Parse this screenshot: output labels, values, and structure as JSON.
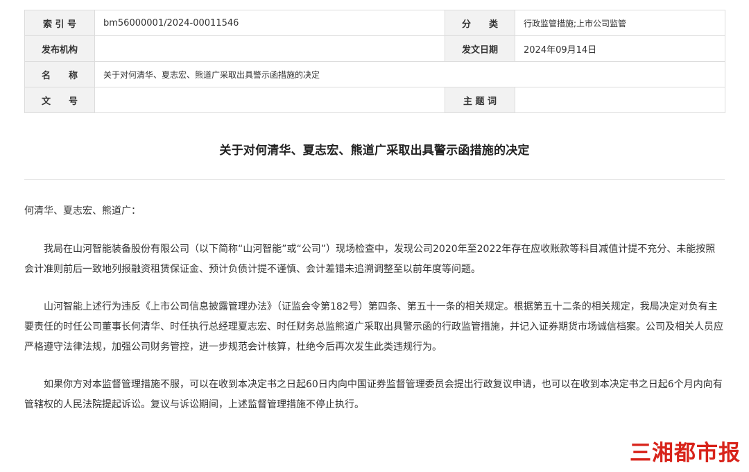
{
  "meta": {
    "index_label": "索 引 号",
    "index_value": "bm56000001/2024-00011546",
    "category_label": "分　　类",
    "category_value": "行政监管措施;上市公司监管",
    "issuer_label": "发布机构",
    "issuer_value": "",
    "date_label": "发文日期",
    "date_value": "2024年09月14日",
    "name_label": "名　　称",
    "name_value": "关于对何清华、夏志宏、熊道广采取出具警示函措施的决定",
    "docno_label": "文　　号",
    "docno_value": "",
    "keywords_label": "主 题 词",
    "keywords_value": ""
  },
  "document": {
    "title": "关于对何清华、夏志宏、熊道广采取出具警示函措施的决定",
    "salutation": "何清华、夏志宏、熊道广：",
    "paragraphs": [
      "我局在山河智能装备股份有限公司（以下简称“山河智能”或“公司”）现场检查中，发现公司2020年至2022年存在应收账款等科目减值计提不充分、未能按照会计准则前后一致地列报融资租赁保证金、预计负债计提不谨慎、会计差错未追溯调整至以前年度等问题。",
      "山河智能上述行为违反《上市公司信息披露管理办法》（证监会令第182号）第四条、第五十一条的相关规定。根据第五十二条的相关规定，我局决定对负有主要责任的时任公司董事长何清华、时任执行总经理夏志宏、时任财务总监熊道广采取出具警示函的行政监管措施，并记入证券期货市场诚信档案。公司及相关人员应严格遵守法律法规，加强公司财务管控，进一步规范会计核算，杜绝今后再次发生此类违规行为。",
      "如果你方对本监督管理措施不服，可以在收到本决定书之日起60日内向中国证券监督管理委员会提出行政复议申请，也可以在收到本决定书之日起6个月内向有管辖权的人民法院提起诉讼。复议与诉讼期间，上述监督管理措施不停止执行。"
    ]
  },
  "watermark": {
    "text": "三湘都市报",
    "color": "#d8231a"
  }
}
